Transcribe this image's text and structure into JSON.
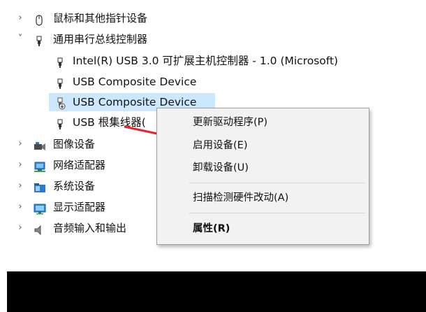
{
  "tree": {
    "items": [
      {
        "label": "鼠标和其他指针设备",
        "expand": "›",
        "icon": "mouse-icon"
      },
      {
        "label": "通用串行总线控制器",
        "expand": "˅",
        "icon": "usb-plug-icon"
      },
      {
        "label": "Intel(R) USB 3.0 可扩展主机控制器 - 1.0 (Microsoft)",
        "icon": "usb-plug-icon"
      },
      {
        "label": "USB Composite Device",
        "icon": "usb-plug-icon"
      },
      {
        "label": "USB Composite Device",
        "icon": "usb-device-disabled-icon",
        "selected": true
      },
      {
        "label": "USB 根集线器(",
        "icon": "usb-plug-icon"
      },
      {
        "label": "图像设备",
        "expand": "›",
        "icon": "camera-icon"
      },
      {
        "label": "网络适配器",
        "expand": "›",
        "icon": "network-adapter-icon"
      },
      {
        "label": "系统设备",
        "expand": "›",
        "icon": "system-folder-icon"
      },
      {
        "label": "显示适配器",
        "expand": "›",
        "icon": "monitor-icon"
      },
      {
        "label": "音频输入和输出",
        "expand": "›",
        "icon": "speaker-icon"
      }
    ]
  },
  "context_menu": {
    "items": [
      {
        "label": "更新驱动程序(P)"
      },
      {
        "label": "启用设备(E)"
      },
      {
        "label": "卸载设备(U)"
      },
      {
        "label": "扫描检测硬件改动(A)"
      },
      {
        "label": "属性(R)",
        "bold": true
      }
    ]
  },
  "colors": {
    "selection": "#cce8ff",
    "arrow": "#e8232a",
    "menu_bg": "#f2f2f2"
  }
}
